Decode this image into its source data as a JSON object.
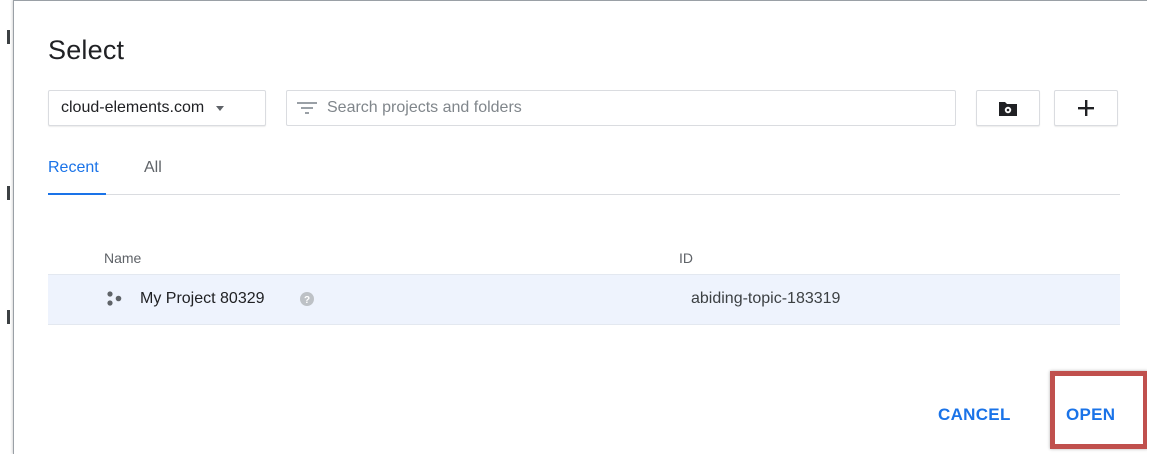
{
  "dialog": {
    "title": "Select"
  },
  "org_select": {
    "value": "cloud-elements.com",
    "icon": "chevron-down-icon"
  },
  "search": {
    "placeholder": "Search projects and folders",
    "value": "",
    "icon": "filter-icon"
  },
  "toolbar": {
    "new_folder_icon": "new-folder-icon",
    "add_icon": "plus-icon"
  },
  "tabs": [
    {
      "label": "Recent",
      "selected": true
    },
    {
      "label": "All",
      "selected": false
    }
  ],
  "table": {
    "columns": [
      "Name",
      "ID"
    ],
    "rows": [
      {
        "name": "My Project 80329",
        "id": "abiding-topic-183319",
        "icon": "project-icon",
        "selected": true
      }
    ]
  },
  "actions": {
    "cancel_label": "CANCEL",
    "open_label": "OPEN"
  },
  "colors": {
    "accent": "#1a73e8",
    "selected_row": "#eef3fd",
    "highlight": "#c0504d"
  }
}
